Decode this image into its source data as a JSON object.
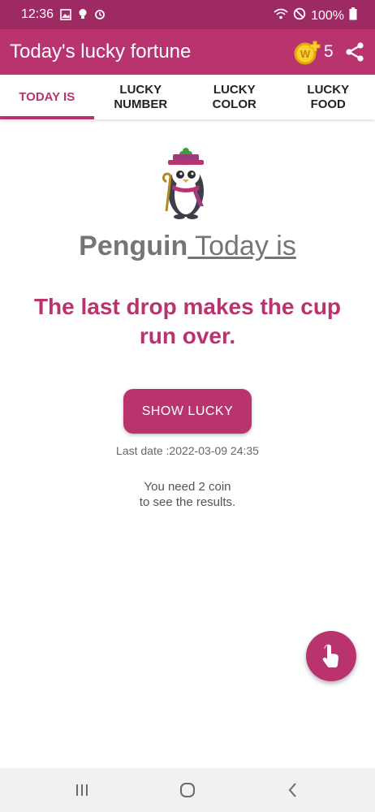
{
  "status_bar": {
    "time": "12:36",
    "battery": "100%",
    "icons": [
      "gallery-icon",
      "bulb-icon",
      "sync-icon",
      "wifi-icon",
      "no-disturb-icon",
      "battery-icon"
    ]
  },
  "app_bar": {
    "title": "Today's lucky fortune",
    "coin_count": "5",
    "coin_letter": "W"
  },
  "tabs": [
    {
      "label": "TODAY IS",
      "active": true
    },
    {
      "label": "LUCKY\nNUMBER",
      "active": false
    },
    {
      "label": "LUCKY\nCOLOR",
      "active": false
    },
    {
      "label": "LUCKY\nFOOD",
      "active": false
    }
  ],
  "main": {
    "animal": "Penguin",
    "today_label": " Today is",
    "fortune": "The last drop makes the cup run over.",
    "show_button": "SHOW LUCKY",
    "last_date": "Last date :2022-03-09 24:35",
    "need_coin_line1": "You need 2 coin",
    "need_coin_line2": "to see the results."
  },
  "colors": {
    "primary": "#b9346e",
    "status_bar": "#9e2a63",
    "coin": "#f2c318"
  }
}
